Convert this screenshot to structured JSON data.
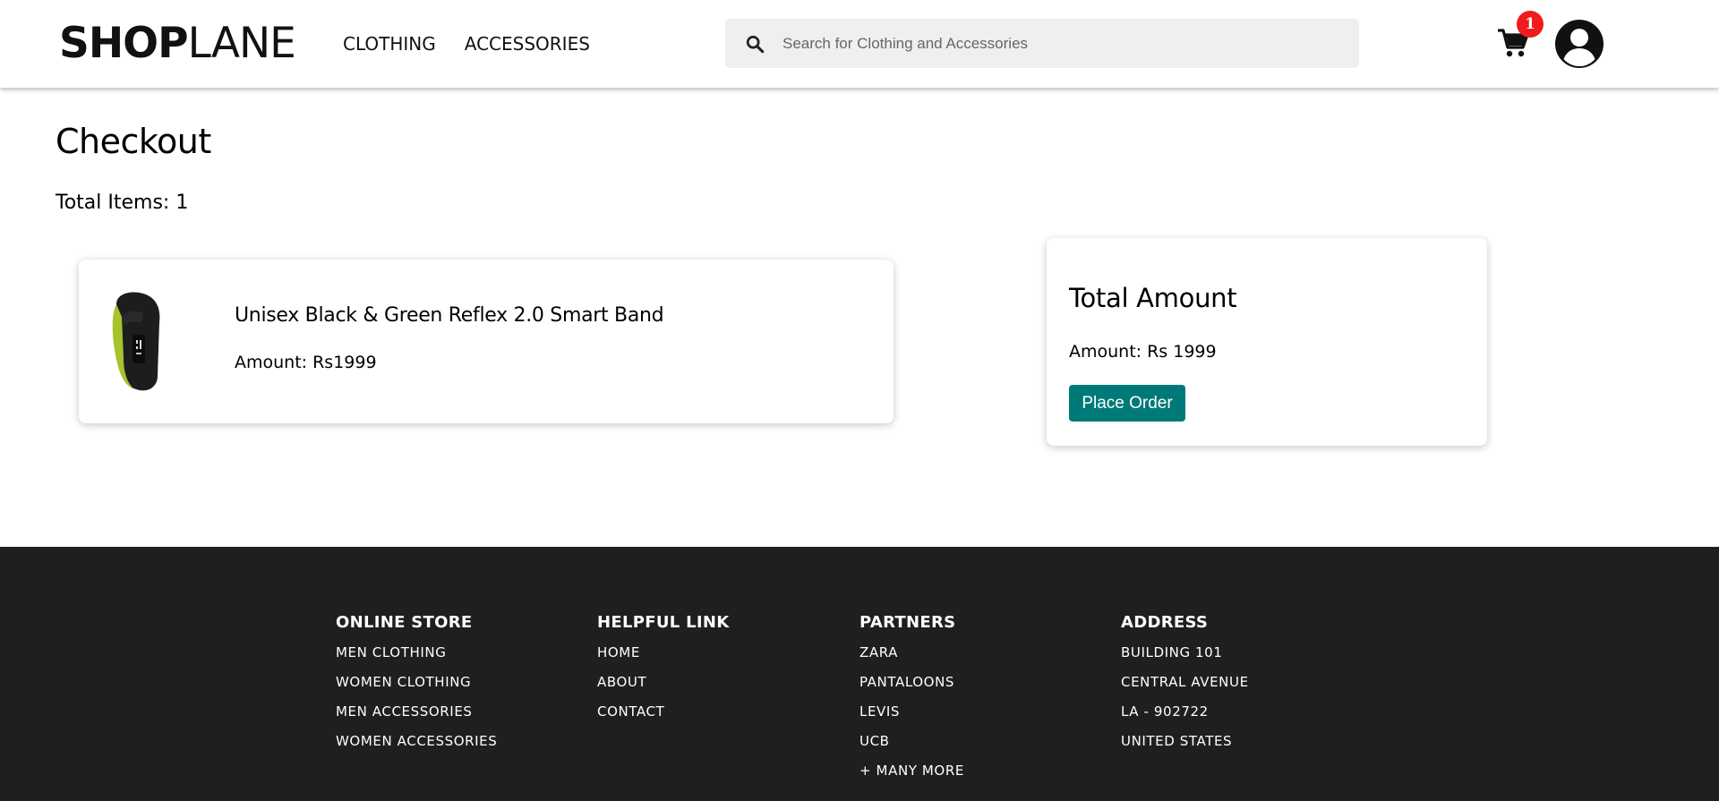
{
  "header": {
    "logo_bold": "SHOP",
    "logo_light": "LANE",
    "nav": [
      "CLOTHING",
      "ACCESSORIES"
    ],
    "search_placeholder": "Search for Clothing and Accessories",
    "cart_count": "1",
    "icons": {
      "search": "search-icon",
      "cart": "shopping-cart-icon",
      "account": "user-circle-icon"
    }
  },
  "main": {
    "title": "Checkout",
    "total_items": "Total Items: 1",
    "item": {
      "name": "Unisex Black & Green Reflex 2.0 Smart Band",
      "amount": "Amount: Rs1999"
    },
    "summary": {
      "title": "Total Amount",
      "amount": "Amount: Rs 1999",
      "button": "Place Order"
    }
  },
  "footer": {
    "columns": [
      {
        "title": "ONLINE STORE",
        "items": [
          "MEN CLOTHING",
          "WOMEN CLOTHING",
          "MEN ACCESSORIES",
          "WOMEN ACCESSORIES"
        ]
      },
      {
        "title": "HELPFUL LINK",
        "items": [
          "HOME",
          "ABOUT",
          "CONTACT"
        ]
      },
      {
        "title": "PARTNERS",
        "items": [
          "ZARA",
          "PANTALOONS",
          "LEVIS",
          "UCB",
          "+ MANY MORE"
        ]
      },
      {
        "title": "ADDRESS",
        "items": [
          "BUILDING 101",
          "CENTRAL AVENUE",
          "LA - 902722",
          "UNITED STATES"
        ]
      }
    ]
  },
  "colors": {
    "accent": "#007a78",
    "badge": "#ee1c1c",
    "footer_bg": "#1f1f1f",
    "search_bg": "#efefef"
  }
}
